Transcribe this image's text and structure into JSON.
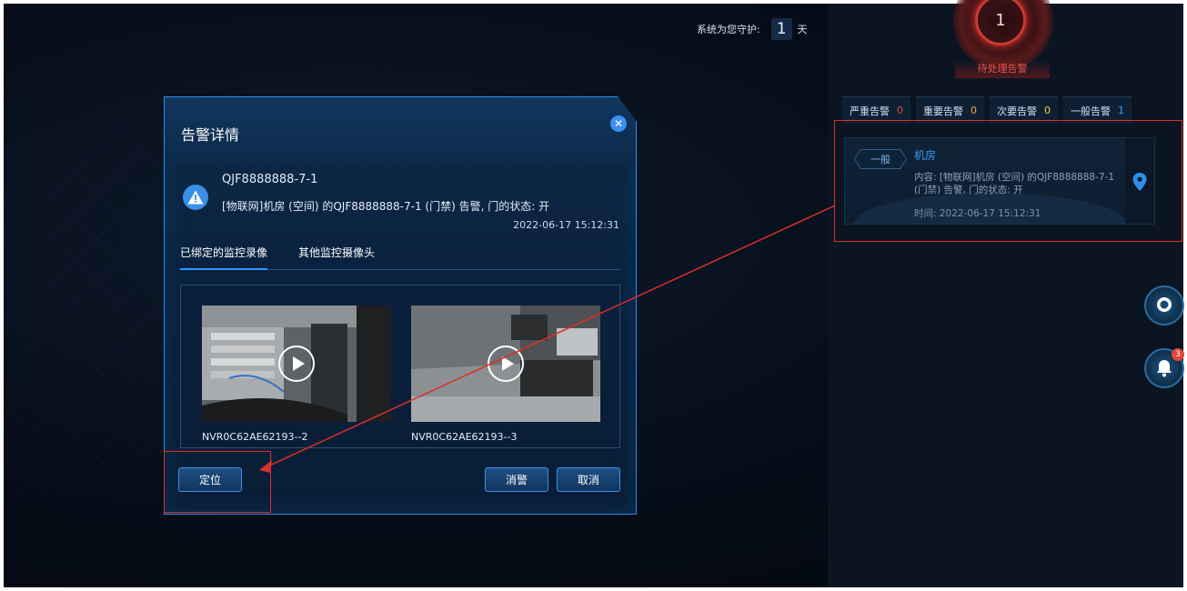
{
  "header": {
    "guard_label": "系统为您守护:",
    "guard_days": "1",
    "guard_unit": "天"
  },
  "pending": {
    "count": "1",
    "label": "待处理告警"
  },
  "level_tabs": [
    {
      "label": "严重告警",
      "count": "0",
      "color": "#e0453a"
    },
    {
      "label": "重要告警",
      "count": "0",
      "color": "#f2a53a"
    },
    {
      "label": "次要告警",
      "count": "0",
      "color": "#f2d23a"
    },
    {
      "label": "一般告警",
      "count": "1",
      "color": "#3a9ff2"
    }
  ],
  "alarm_card": {
    "level": "一般",
    "title": "机房",
    "content": "内容: [物联网]机房 (空间) 的QJF8888888-7-1 (门禁) 告警, 门的状态: 开",
    "time": "时间: 2022-06-17 15:12:31"
  },
  "side_buttons": {
    "bell_count": "3"
  },
  "dialog": {
    "title": "告警详情",
    "device": "QJF8888888-7-1",
    "message": "[物联网]机房 (空间) 的QJF8888888-7-1 (门禁) 告警, 门的状态: 开",
    "time": "2022-06-17 15:12:31",
    "tabs": [
      "已绑定的监控录像",
      "其他监控摄像头"
    ],
    "videos": [
      {
        "label": "NVR0C62AE62193--2"
      },
      {
        "label": "NVR0C62AE62193--3"
      }
    ],
    "locate_label": "定位",
    "dismiss_label": "消警",
    "cancel_label": "取消"
  },
  "colors": {
    "accent": "#2f97ff",
    "annotation": "#d8302a"
  }
}
